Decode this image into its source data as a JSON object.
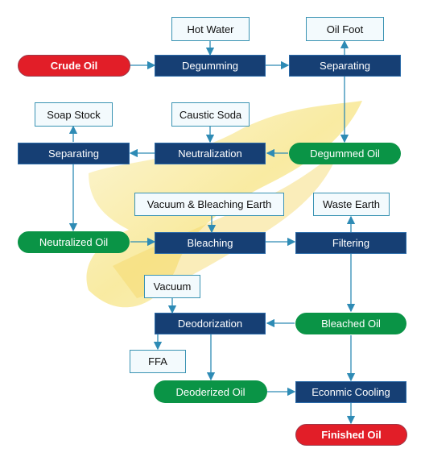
{
  "diagram": {
    "colors": {
      "process": "#163f74",
      "input": "#f3fafd",
      "oil": "#0a9446",
      "endpoint": "#e21e28",
      "connector": "#2e8bb5"
    },
    "nodes": {
      "crude_oil": "Crude Oil",
      "hot_water": "Hot Water",
      "degumming": "Degumming",
      "oil_foot": "Oil Foot",
      "separating_1": "Separating",
      "soap_stock": "Soap Stock",
      "caustic_soda": "Caustic Soda",
      "separating_2": "Separating",
      "neutralization": "Neutralization",
      "degummed_oil": "Degummed Oil",
      "vacuum_bleaching_earth": "Vacuum & Bleaching Earth",
      "waste_earth": "Waste Earth",
      "neutralized_oil": "Neutralized Oil",
      "bleaching": "Bleaching",
      "filtering": "Filtering",
      "vacuum": "Vacuum",
      "deodorization": "Deodorization",
      "bleached_oil": "Bleached Oil",
      "ffa": "FFA",
      "deoderized_oil": "Deoderized Oil",
      "econmic_cooling": "Econmic Cooling",
      "finished_oil": "Finished Oil"
    },
    "edges": [
      [
        "crude_oil",
        "degumming"
      ],
      [
        "hot_water",
        "degumming"
      ],
      [
        "degumming",
        "separating_1"
      ],
      [
        "separating_1",
        "oil_foot"
      ],
      [
        "separating_1",
        "degummed_oil"
      ],
      [
        "degummed_oil",
        "neutralization"
      ],
      [
        "caustic_soda",
        "neutralization"
      ],
      [
        "neutralization",
        "separating_2"
      ],
      [
        "separating_2",
        "soap_stock"
      ],
      [
        "separating_2",
        "neutralized_oil"
      ],
      [
        "neutralized_oil",
        "bleaching"
      ],
      [
        "vacuum_bleaching_earth",
        "bleaching"
      ],
      [
        "bleaching",
        "filtering"
      ],
      [
        "filtering",
        "waste_earth"
      ],
      [
        "filtering",
        "bleached_oil"
      ],
      [
        "bleached_oil",
        "deodorization"
      ],
      [
        "vacuum",
        "deodorization"
      ],
      [
        "deodorization",
        "ffa"
      ],
      [
        "deodorization",
        "deoderized_oil"
      ],
      [
        "deoderized_oil",
        "econmic_cooling"
      ],
      [
        "bleached_oil",
        "econmic_cooling"
      ],
      [
        "econmic_cooling",
        "finished_oil"
      ]
    ]
  }
}
